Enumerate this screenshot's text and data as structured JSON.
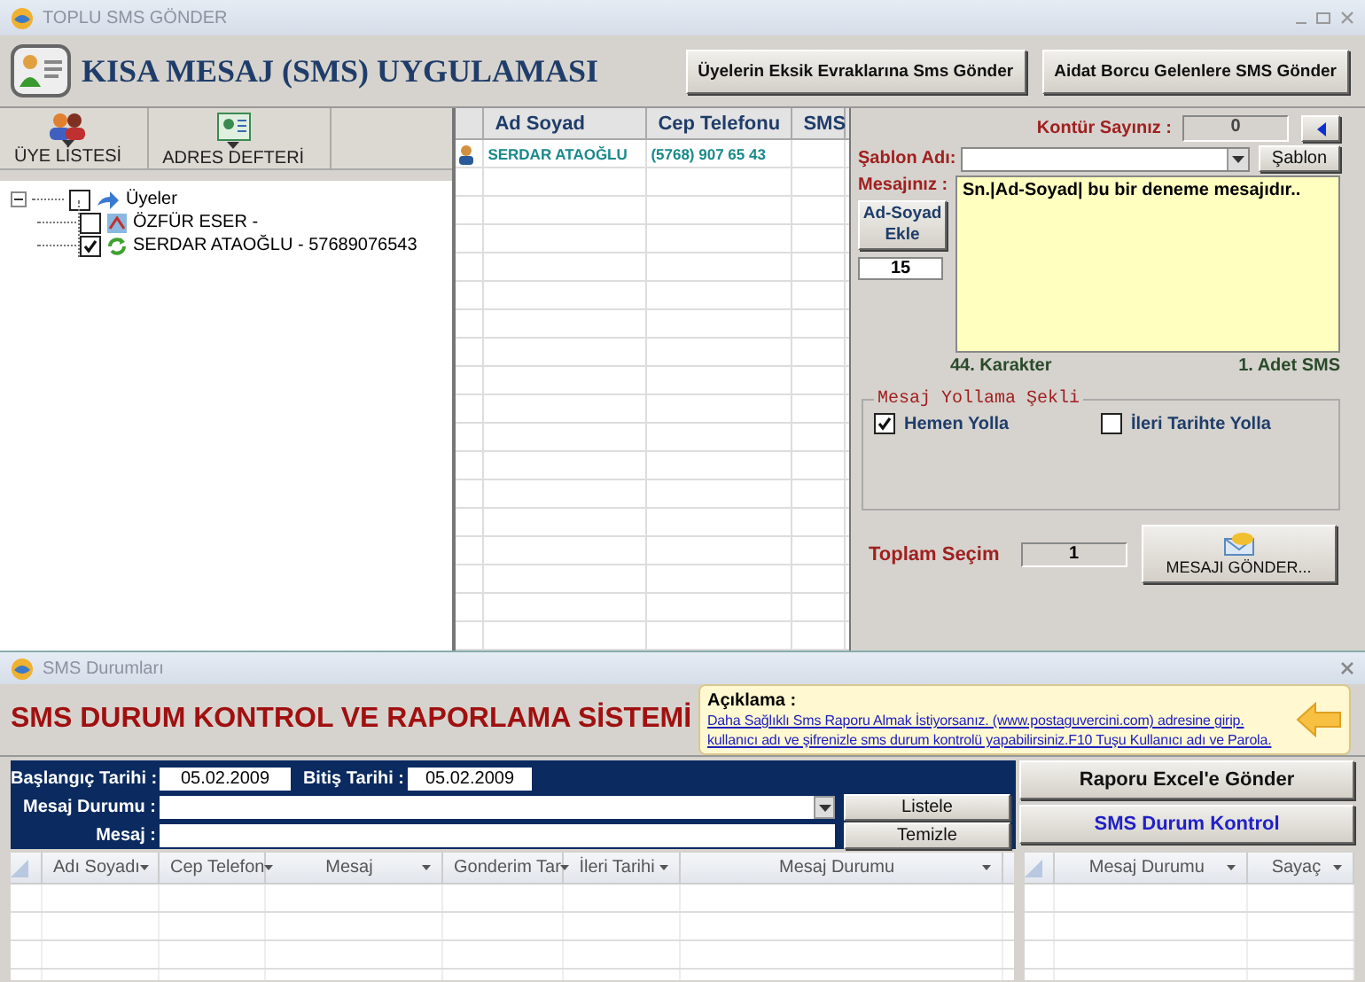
{
  "main_window": {
    "title": "TOPLU SMS GÖNDER"
  },
  "header": {
    "title": "KISA MESAJ (SMS) UYGULAMASI",
    "buttons": [
      "Üyelerin Eksik Evraklarına Sms Gönder",
      "Aidat Borcu Gelenlere SMS Gönder"
    ]
  },
  "toolbar": [
    {
      "label": "ÜYE LİSTESİ",
      "kind": "members"
    },
    {
      "label": "ADRES DEFTERİ",
      "kind": "addressbook"
    }
  ],
  "tree": {
    "label": "Üyeler",
    "checked": false,
    "expanded": true,
    "children": [
      {
        "label": "ÖZFÜR ESER -",
        "checked": false,
        "kind": "pending"
      },
      {
        "label": "SERDAR ATAOĞLU - 57689076543",
        "checked": true,
        "kind": "synced"
      }
    ]
  },
  "recipients_table": {
    "columns": [
      "Ad Soyad",
      "Cep Telefonu",
      "SMS"
    ],
    "rows": [
      [
        "SERDAR ATAOĞLU",
        "(5768) 907 65 43"
      ]
    ]
  },
  "sms_panel": {
    "credit_label": "Kontür Sayınız :",
    "credit_value": "0",
    "template_label": "Şablon Adı:",
    "template_button": "Şablon",
    "message_label": "Mesajınız :",
    "message": "Sn.|Ad-Soyad| bu bir deneme mesajıdır..",
    "add_name_button": "Ad-Soyad Ekle",
    "name_length": "15",
    "char_count": "44. Karakter",
    "sms_count": "1. Adet SMS",
    "send_mode": {
      "title": "Mesaj Yollama Şekli",
      "options": [
        {
          "label": "Hemen Yolla",
          "checked": true
        },
        {
          "label": "İleri Tarihte Yolla",
          "checked": false
        }
      ]
    },
    "total_label": "Toplam Seçim",
    "total_value": "1",
    "send_button": "MESAJI GÖNDER..."
  },
  "status_window": {
    "title": "SMS Durumları",
    "heading": "SMS DURUM KONTROL VE RAPORLAMA SİSTEMİ",
    "note": {
      "title": "Açıklama :",
      "link": "Daha Sağlıklı Sms Raporu Almak İstiyorsanız. (www.postaguvercini.com) adresine girip. kullanıcı adı ve şifrenizle sms durum kontrolü yapabilirsiniz.F10 Tuşu Kullanıcı adı ve Parola."
    },
    "filters": {
      "start_label": "Başlangıç Tarihi :",
      "start_value": "05.02.2009",
      "end_label": "Bitiş Tarihi :",
      "end_value": "05.02.2009",
      "status_label": "Mesaj Durumu :",
      "message_label": "Mesaj :"
    },
    "filter_buttons": [
      "Listele",
      "Temizle"
    ],
    "side_buttons": [
      {
        "label": "Raporu Excel'e Gönder",
        "kind": "export"
      },
      {
        "label": "SMS Durum Kontrol",
        "kind": "check"
      }
    ],
    "report_table": {
      "columns": [
        "Adı Soyadı",
        "Cep Telefon",
        "Mesaj",
        "Gonderim Tar",
        "İleri Tarihi",
        "Mesaj Durumu"
      ]
    },
    "summary_table": {
      "columns": [
        "Mesaj Durumu",
        "Sayaç"
      ]
    }
  }
}
